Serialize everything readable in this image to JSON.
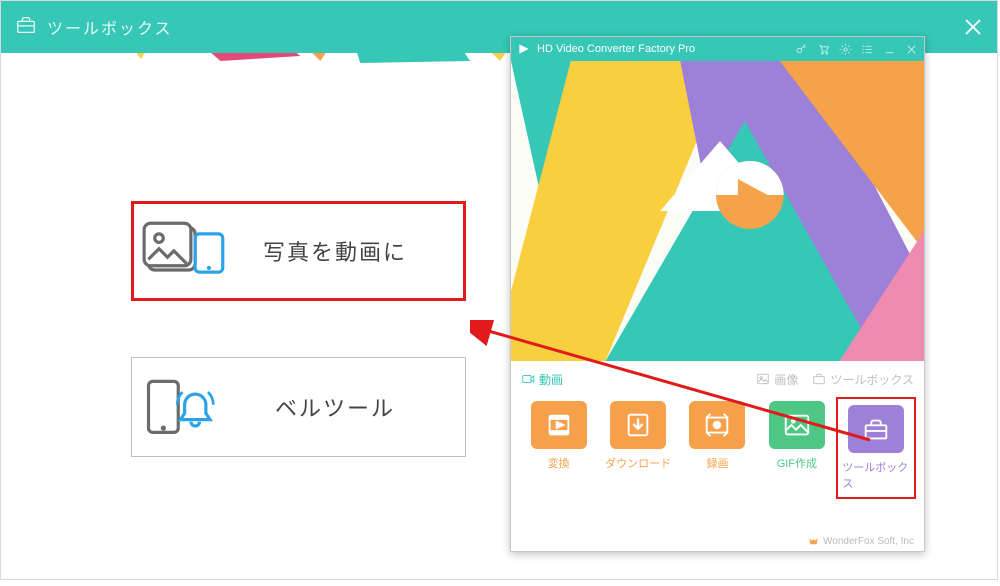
{
  "parent": {
    "title": "ツールボックス",
    "option1_label": "写真を動画に",
    "option2_label": "ベルツール"
  },
  "app": {
    "title": "HD Video Converter Factory Pro",
    "sections": {
      "video": "動画",
      "image": "画像",
      "toolbox": "ツールボックス"
    },
    "tools": {
      "convert": "変換",
      "download": "ダウンロード",
      "record": "録画",
      "gif": "GIF作成",
      "toolbox": "ツールボックス"
    },
    "footer": "WonderFox Soft, Inc"
  }
}
